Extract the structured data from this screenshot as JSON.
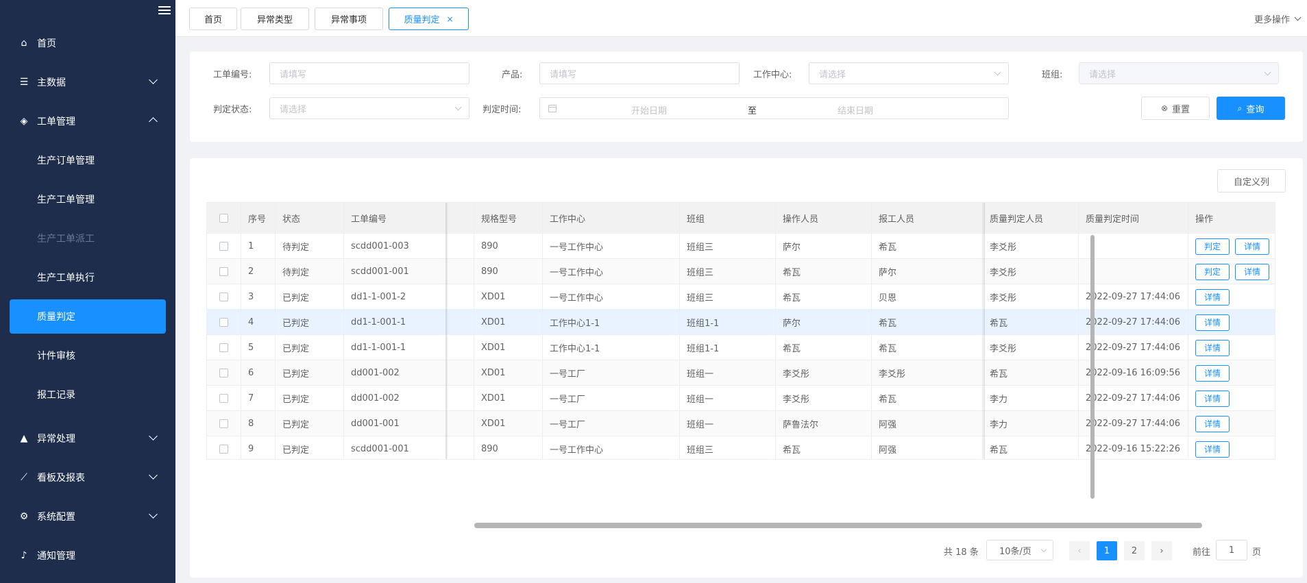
{
  "sidebar": {
    "menu": [
      {
        "label": "首页",
        "icon": "home-icon"
      },
      {
        "label": "主数据",
        "icon": "list-icon"
      },
      {
        "label": "工单管理",
        "icon": "layers-icon"
      },
      {
        "label": "异常处理",
        "icon": "warning-icon"
      },
      {
        "label": "看板及报表",
        "icon": "chart-icon"
      },
      {
        "label": "系统配置",
        "icon": "settings-icon"
      },
      {
        "label": "通知管理",
        "icon": "bell-icon"
      }
    ],
    "submenu": [
      {
        "label": "生产订单管理"
      },
      {
        "label": "生产工单管理"
      },
      {
        "label": "生产工单派工"
      },
      {
        "label": "生产工单执行"
      },
      {
        "label": "质量判定"
      },
      {
        "label": "计件审核"
      },
      {
        "label": "报工记录"
      }
    ]
  },
  "tabs": [
    {
      "label": "首页"
    },
    {
      "label": "异常类型"
    },
    {
      "label": "异常事项"
    },
    {
      "label": "质量判定",
      "close": "×"
    }
  ],
  "more_ops": "更多操作",
  "filter": {
    "order_no_label": "工单编号:",
    "order_no_placeholder": "请填写",
    "product_label": "产品:",
    "product_placeholder": "请填写",
    "workcenter_label": "工作中心:",
    "workcenter_placeholder": "请选择",
    "team_label": "班组:",
    "team_placeholder": "请选择",
    "status_label": "判定状态:",
    "status_placeholder": "请选择",
    "time_label": "判定时间:",
    "start_date": "开始日期",
    "date_sep": "至",
    "end_date": "结束日期",
    "reset": "重置",
    "query": "查询"
  },
  "custom_columns": "自定义列",
  "table": {
    "headers": [
      "序号",
      "状态",
      "工单编号",
      "规格型号",
      "工作中心",
      "班组",
      "操作人员",
      "报工人员",
      "质量判定人员",
      "质量判定时间",
      "操作"
    ],
    "rows": [
      {
        "no": "1",
        "status": "待判定",
        "order": "scdd001-003",
        "spec": "890",
        "wc": "一号工作中心",
        "team": "班组三",
        "op": "萨尔",
        "rep": "希瓦",
        "qj": "李爻彤",
        "qt": "",
        "btns": [
          "判定",
          "详情"
        ]
      },
      {
        "no": "2",
        "status": "待判定",
        "order": "scdd001-001",
        "spec": "890",
        "wc": "一号工作中心",
        "team": "班组三",
        "op": "希瓦",
        "rep": "萨尔",
        "qj": "李爻彤",
        "qt": "",
        "btns": [
          "判定",
          "详情"
        ]
      },
      {
        "no": "3",
        "status": "已判定",
        "order": "dd1-1-001-2",
        "spec": "XD01",
        "wc": "一号工作中心",
        "team": "班组三",
        "op": "希瓦",
        "rep": "贝恩",
        "qj": "李爻彤",
        "qt": "2022-09-27 17:44:06",
        "btns": [
          "详情"
        ]
      },
      {
        "no": "4",
        "status": "已判定",
        "order": "dd1-1-001-1",
        "spec": "XD01",
        "wc": "工作中心1-1",
        "team": "班组1-1",
        "op": "萨尔",
        "rep": "希瓦",
        "qj": "希瓦",
        "qt": "2022-09-27 17:44:06",
        "btns": [
          "详情"
        ]
      },
      {
        "no": "5",
        "status": "已判定",
        "order": "dd1-1-001-1",
        "spec": "XD01",
        "wc": "工作中心1-1",
        "team": "班组1-1",
        "op": "希瓦",
        "rep": "希瓦",
        "qj": "李爻彤",
        "qt": "2022-09-27 17:44:06",
        "btns": [
          "详情"
        ]
      },
      {
        "no": "6",
        "status": "已判定",
        "order": "dd001-002",
        "spec": "XD01",
        "wc": "一号工厂",
        "team": "班组一",
        "op": "李爻彤",
        "rep": "李爻彤",
        "qj": "希瓦",
        "qt": "2022-09-16 16:09:56",
        "btns": [
          "详情"
        ]
      },
      {
        "no": "7",
        "status": "已判定",
        "order": "dd001-002",
        "spec": "XD01",
        "wc": "一号工厂",
        "team": "班组一",
        "op": "李爻彤",
        "rep": "希瓦",
        "qj": "李力",
        "qt": "2022-09-27 17:44:06",
        "btns": [
          "详情"
        ]
      },
      {
        "no": "8",
        "status": "已判定",
        "order": "dd001-001",
        "spec": "XD01",
        "wc": "一号工厂",
        "team": "班组一",
        "op": "萨鲁法尔",
        "rep": "阿强",
        "qj": "李力",
        "qt": "2022-09-27 17:44:06",
        "btns": [
          "详情"
        ]
      },
      {
        "no": "9",
        "status": "已判定",
        "order": "scdd001-001",
        "spec": "890",
        "wc": "一号工作中心",
        "team": "班组三",
        "op": "希瓦",
        "rep": "阿强",
        "qj": "希瓦",
        "qt": "2022-09-16 15:22:26",
        "btns": [
          "详情"
        ]
      }
    ]
  },
  "pagination": {
    "total": "共 18 条",
    "page_size": "10条/页",
    "pages": [
      "1",
      "2"
    ],
    "goto_label": "前往",
    "goto_value": "1",
    "page_suffix": "页",
    "prev": "‹",
    "next": "›"
  }
}
